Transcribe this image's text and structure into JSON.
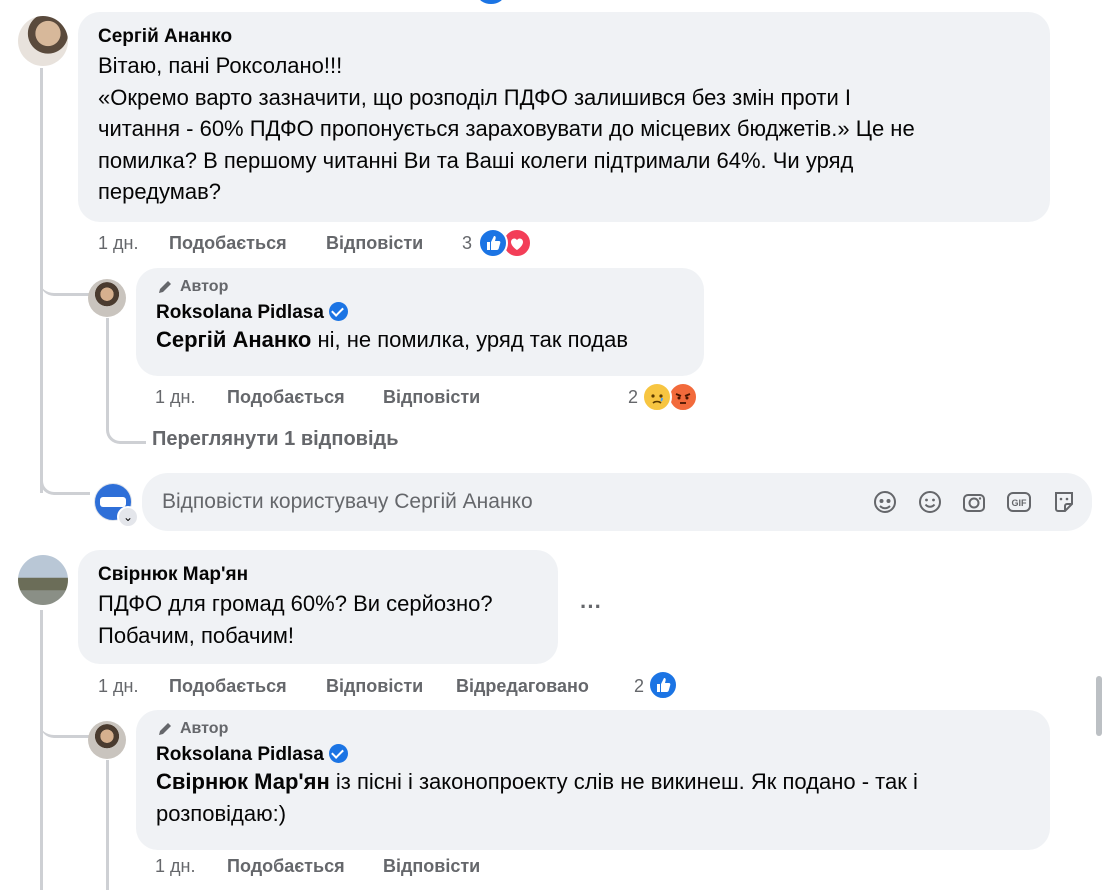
{
  "comment1": {
    "author": "Сергій Ананко",
    "lines": [
      "Вітаю, пані Роксолано!!!",
      "«Окремо варто зазначити, що розподіл ПДФО залишився без змін проти І",
      "читання - 60% ПДФО пропонується зараховувати до місцевих бюджетів.» Це не",
      "помилка? В першому читанні Ви та Ваші колеги підтримали 64%. Чи уряд",
      "передумав?"
    ],
    "time": "1 дн.",
    "like_label": "Подобається",
    "reply_label": "Відповісти",
    "reaction_count": "3",
    "reactions": [
      "like-icon",
      "love-icon"
    ]
  },
  "reply1": {
    "author_tag": "Автор",
    "author": "Roksolana Pidlasa",
    "mention": "Сергій Ананко",
    "text": " ні, не помилка, уряд так подав",
    "time": "1 дн.",
    "like_label": "Подобається",
    "reply_label": "Відповісти",
    "reaction_count": "2",
    "reactions": [
      "sad-icon",
      "angry-icon"
    ]
  },
  "view_replies": "Переглянути 1 відповідь",
  "reply_input": {
    "placeholder": "Відповісти користувачу Сергій Ананко",
    "tools": [
      "avatar-sticker-icon",
      "emoji-icon",
      "camera-icon",
      "gif-icon",
      "sticker-icon"
    ]
  },
  "comment2": {
    "author": "Свірнюк Мар'ян",
    "lines": [
      "ПДФО для громад 60%? Ви серйозно?",
      "Побачим, побачим!"
    ],
    "more": "···",
    "time": "1 дн.",
    "like_label": "Подобається",
    "reply_label": "Відповісти",
    "edited_label": "Відредаговано",
    "reaction_count": "2",
    "reactions": [
      "like-icon"
    ]
  },
  "reply2": {
    "author_tag": "Автор",
    "author": "Roksolana Pidlasa",
    "mention": "Свірнюк Мар'ян",
    "text_line1": " із пісні і законопроекту слів не викинеш. Як подано - так і",
    "text_line2": "розповідаю:)",
    "time": "1 дн.",
    "like_label": "Подобається",
    "reply_label": "Відповісти"
  },
  "colors": {
    "bubble": "#f0f2f5",
    "meta": "#65676b",
    "like_blue": "#1b74e4",
    "love_red": "#f33e58",
    "thread_line": "#ced0d4"
  }
}
